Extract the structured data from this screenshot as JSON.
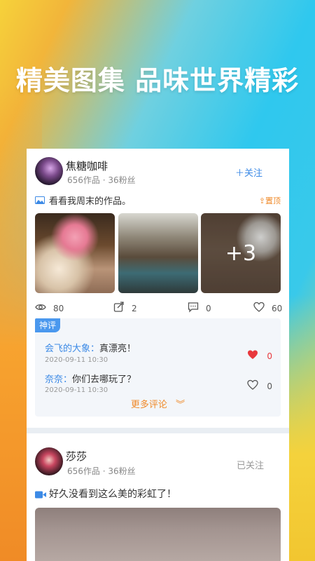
{
  "headline": "精美图集 品味世界精彩",
  "post1": {
    "username": "焦糖咖啡",
    "meta": "656作品 · 36粉丝",
    "follow_label": "＋关注",
    "caption": "看看我周末的作品。",
    "pin_label": "置顶",
    "more_count": "+3",
    "stats": {
      "views": "80",
      "shares": "2",
      "comments": "0",
      "likes": "60"
    },
    "badge": "神评",
    "comments": [
      {
        "name": "会飞的大象：",
        "text": "真漂亮！",
        "time": "2020-09-11  10:30",
        "likes": "0",
        "liked": true
      },
      {
        "name": "奈奈：",
        "text": "你们去哪玩了？",
        "time": "2020-09-11  10:30",
        "likes": "0",
        "liked": false
      }
    ],
    "more_comments": "更多评论"
  },
  "post2": {
    "username": "莎莎",
    "meta": "656作品 · 36粉丝",
    "follow_label": "已关注",
    "caption": "好久没看到这么美的彩虹了！"
  },
  "colors": {
    "accent": "#3c8ae6",
    "orange": "#ef8a2a",
    "like_red": "#e8383d"
  }
}
